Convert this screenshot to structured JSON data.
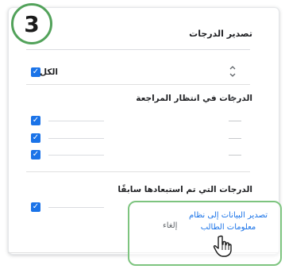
{
  "step": {
    "number": "3",
    "color": "#52a25a"
  },
  "dialog": {
    "title": "تصدير الدرجات"
  },
  "all": {
    "label": "الكل",
    "checked": true,
    "icon": "collapse-expand-icon"
  },
  "sections": [
    {
      "header": "الدرجات في انتظار المراجعة",
      "icon": "chevron-up-icon",
      "items": [
        {
          "checked": true
        },
        {
          "checked": true
        },
        {
          "checked": true
        }
      ]
    },
    {
      "header": "الدرجات التي تم استبعادها سابقًا",
      "items": [
        {
          "checked": true
        }
      ]
    }
  ],
  "actions": {
    "cancel": "إلغاء",
    "export_line1": "تصدير البيانات إلى نظام",
    "export_line2": "معلومات الطالب"
  },
  "colors": {
    "accent": "#1a73e8",
    "highlight": "#7dc47f"
  }
}
